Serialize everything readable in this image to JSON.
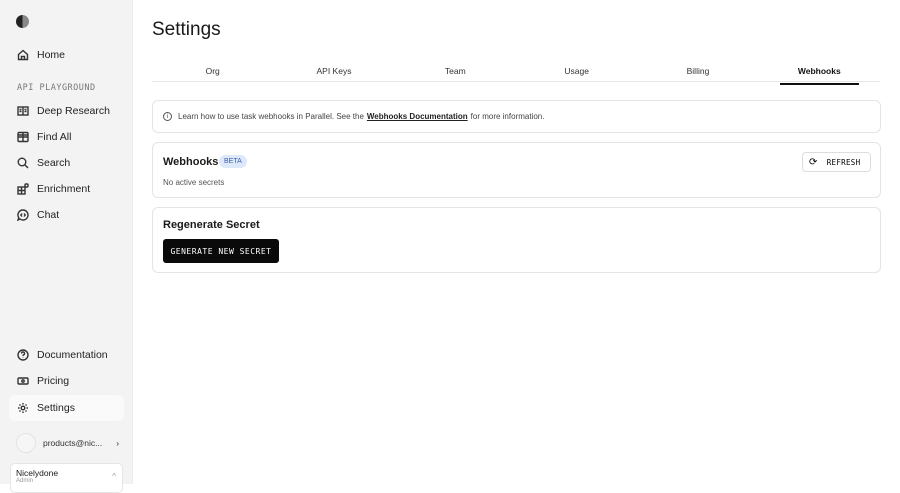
{
  "sidebar": {
    "home": "Home",
    "section": "API PLAYGROUND",
    "items": [
      "Deep Research",
      "Find All",
      "Search",
      "Enrichment",
      "Chat"
    ],
    "bottom": [
      "Documentation",
      "Pricing",
      "Settings"
    ],
    "user_email": "products@nic...",
    "org_name": "Nicelydone",
    "org_role": "Admin"
  },
  "page": {
    "title": "Settings",
    "tabs": [
      "Org",
      "API Keys",
      "Team",
      "Usage",
      "Billing",
      "Webhooks"
    ]
  },
  "info": {
    "before": "Learn how to use task webhooks in Parallel. See the",
    "link": "Webhooks Documentation",
    "after": "for more information."
  },
  "webhooks": {
    "title": "Webhooks",
    "badge": "BETA",
    "status": "No active secrets",
    "refresh": "REFRESH"
  },
  "regen": {
    "title": "Regenerate Secret",
    "button": "GENERATE NEW SECRET"
  }
}
